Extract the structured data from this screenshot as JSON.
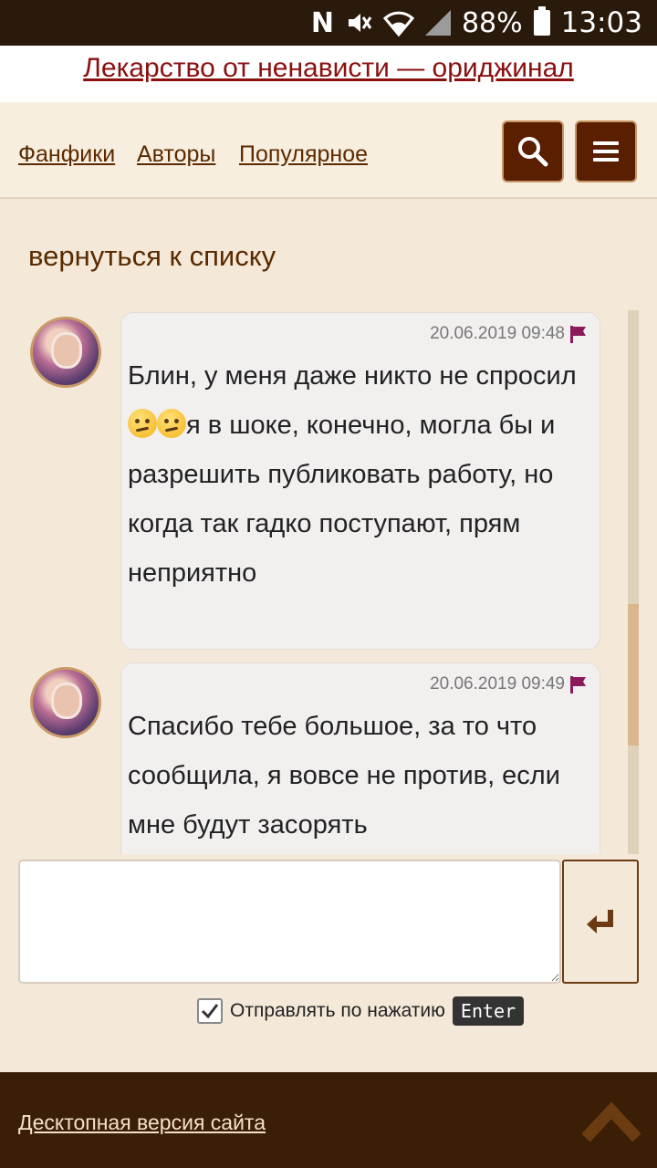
{
  "status_bar": {
    "battery": "88%",
    "time": "13:03",
    "icons": [
      "nfc-icon",
      "mute-icon",
      "wifi-icon",
      "signal-icon",
      "battery-icon"
    ]
  },
  "title": "Лекарство от ненависти — ориджинал",
  "nav": {
    "links": [
      "Фанфики",
      "Авторы",
      "Популярное"
    ],
    "search_icon": "search-icon",
    "menu_icon": "menu-icon"
  },
  "back_link": "вернуться к списку",
  "messages": [
    {
      "date": "20.06.2019 09:48",
      "text_before": "Блин, у меня даже никто не спросил",
      "emojis": [
        "confused-face",
        "confused-face"
      ],
      "text_after": "я в шоке, конечно, могла бы и разрешить публиковать работу, но когда так гадко поступают, прям неприятно"
    },
    {
      "date": "20.06.2019 09:49",
      "text": "Спасибо тебе большое, за то что сообщила, я вовсе не против, если мне будут засорять"
    }
  ],
  "composer": {
    "input_value": "",
    "send_icon": "enter-return-icon",
    "checkbox_checked": true,
    "checkbox_label": "Отправлять по нажатию",
    "key_label": "Enter"
  },
  "footer": {
    "desktop_link": "Десктопная версия сайта",
    "up_icon": "scroll-up-icon"
  },
  "colors": {
    "header_dark": "#2a1a0c",
    "title_link": "#8a1010",
    "accent_brown": "#5a1e00",
    "page_bg": "#f4e9d8",
    "footer_bg": "#3a1e06"
  }
}
